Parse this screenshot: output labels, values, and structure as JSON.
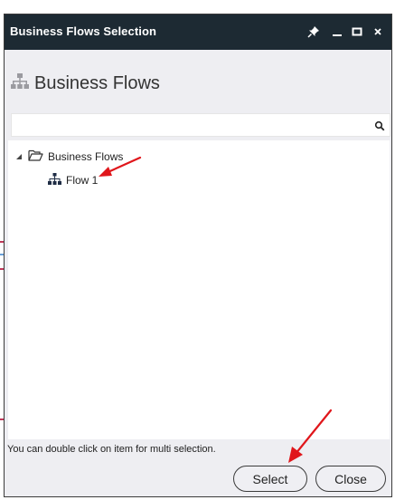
{
  "window": {
    "title": "Business Flows Selection",
    "pin_icon": "pin-icon",
    "minimize_icon": "minimize-icon",
    "maximize_icon": "maximize-icon",
    "close_icon": "close-icon"
  },
  "header": {
    "icon": "business-flows-icon",
    "title": "Business Flows"
  },
  "search": {
    "value": "",
    "placeholder": "",
    "icon": "search-icon"
  },
  "tree": {
    "root": {
      "label": "Business Flows",
      "expanded": true,
      "icon": "folder-open-icon"
    },
    "items": [
      {
        "label": "Flow 1",
        "icon": "flow-icon"
      }
    ]
  },
  "footer": {
    "hint": "You can double click on item for multi selection.",
    "select_label": "Select",
    "close_label": "Close"
  },
  "colors": {
    "titlebar": "#1d2a33",
    "body": "#eeeef2",
    "annotation_arrow": "#e0161b"
  }
}
